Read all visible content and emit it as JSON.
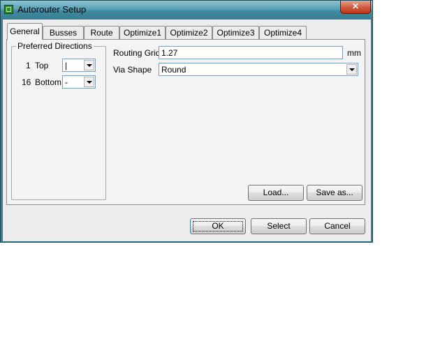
{
  "window": {
    "title": "Autorouter Setup",
    "close_glyph": "✕"
  },
  "tabs": [
    {
      "label": "General",
      "active": true
    },
    {
      "label": "Busses",
      "active": false
    },
    {
      "label": "Route",
      "active": false
    },
    {
      "label": "Optimize1",
      "active": false
    },
    {
      "label": "Optimize2",
      "active": false
    },
    {
      "label": "Optimize3",
      "active": false
    },
    {
      "label": "Optimize4",
      "active": false
    }
  ],
  "preferred_directions": {
    "legend": "Preferred Directions",
    "layers": [
      {
        "number": "1",
        "name": "Top",
        "value": "|"
      },
      {
        "number": "16",
        "name": "Bottom",
        "value": "-"
      }
    ]
  },
  "routing_grid": {
    "label": "Routing Grid",
    "value": "1.27",
    "unit": "mm"
  },
  "via_shape": {
    "label": "Via Shape",
    "value": "Round"
  },
  "tab_buttons": {
    "load": "Load...",
    "save_as": "Save as..."
  },
  "dialog_buttons": {
    "ok": "OK",
    "select": "Select",
    "cancel": "Cancel"
  },
  "icons": {
    "app": "app-icon",
    "close": "close-icon",
    "dropdown": "chevron-down-icon"
  }
}
